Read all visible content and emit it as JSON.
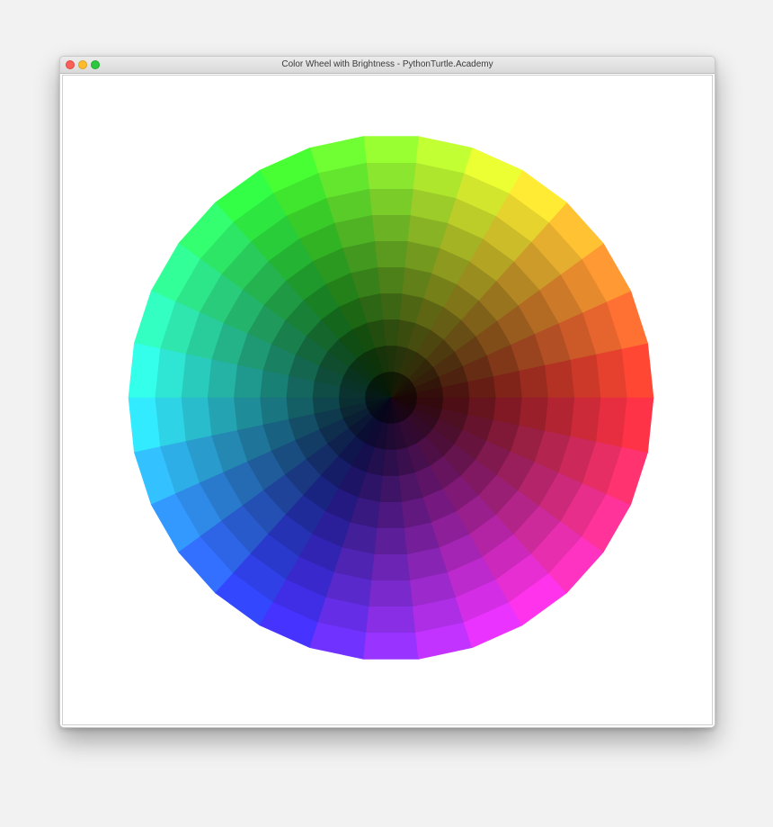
{
  "window": {
    "title": "Color Wheel with Brightness - PythonTurtle.Academy",
    "controls": [
      "close-icon",
      "minimize-icon",
      "maximize-icon"
    ],
    "control_colors": {
      "close": "#fc5f57",
      "minimize": "#fdbc2e",
      "maximize": "#2bc740"
    }
  },
  "canvas": {
    "background": "#ffffff",
    "wheel": {
      "hue_segments": 30,
      "brightness_rings": 10,
      "hue_at_east": 0,
      "hue_direction": "counterclockwise",
      "saturation": 0.8
    }
  }
}
